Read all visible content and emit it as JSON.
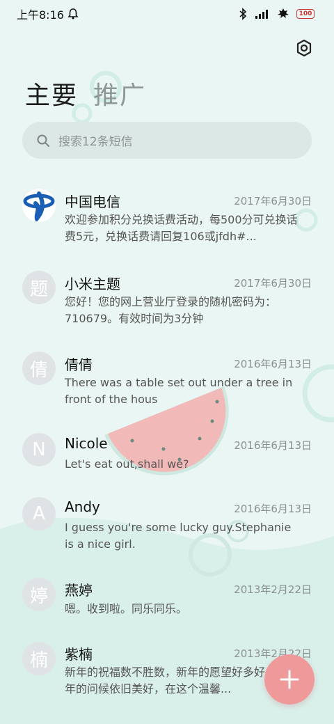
{
  "status_bar": {
    "time": "上午8:16",
    "battery": "100"
  },
  "tabs": [
    {
      "label": "主要"
    },
    {
      "label": "推广"
    }
  ],
  "search": {
    "placeholder": "搜索12条短信"
  },
  "messages": [
    {
      "avatar_char": "",
      "avatar_icon": "china-telecom-logo",
      "name": "中国电信",
      "date": "2017年6月30日",
      "preview": "欢迎参加积分兑换话费活动，每500分可兑换话费5元，兑换话费请回复106或jfdh#..."
    },
    {
      "avatar_char": "题",
      "name": "小米主题",
      "date": "2017年6月30日",
      "preview": "您好！您的网上营业厅登录的随机密码为：710679。有效时间为3分钟"
    },
    {
      "avatar_char": "倩",
      "name": "倩倩",
      "date": "2016年6月13日",
      "preview": "There was a table set out under a tree in front of the hous"
    },
    {
      "avatar_char": "N",
      "name": "Nicole",
      "date": "2016年6月13日",
      "preview": "Let's eat out,shall we?"
    },
    {
      "avatar_char": "A",
      "name": "Andy",
      "date": "2016年6月13日",
      "preview": "I guess you're some lucky guy.Stephanie is a nice girl."
    },
    {
      "avatar_char": "婷",
      "name": "燕婷",
      "date": "2013年2月22日",
      "preview": "嗯。收到啦。同乐同乐。"
    },
    {
      "avatar_char": "楠",
      "name": "紫楠",
      "date": "2013年2月22日",
      "preview": "新年的祝福数不胜数，新年的愿望好多好多，新年的问候依旧美好，在这个温馨..."
    }
  ],
  "colors": {
    "background": "#eaf6f3",
    "accent_fab": "#ee9a9a",
    "watermelon": "#f2b9b9"
  }
}
